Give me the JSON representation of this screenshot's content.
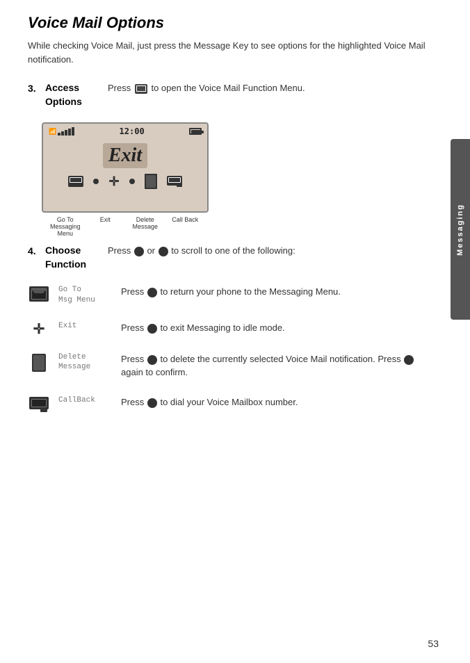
{
  "page": {
    "title": "Voice Mail Options",
    "intro": "While checking Voice Mail, just press the Message Key to see options for the highlighted Voice Mail notification.",
    "page_number": "53",
    "side_tab": "Messaging"
  },
  "steps": [
    {
      "number": "3.",
      "label": "Access\nOptions",
      "description": "Press  to open the Voice Mail Function Menu."
    },
    {
      "number": "4.",
      "label": "Choose\nFunction",
      "description": "Press  or  to scroll to one of the following:"
    }
  ],
  "screen": {
    "time": "12:00",
    "exit_text": "Exit"
  },
  "screen_labels": [
    "Go To\nMessaging\nMenu",
    "Exit",
    "Delete\nMessage",
    "Call Back"
  ],
  "functions": [
    {
      "icon_type": "envelope",
      "name": "Go To\nMsg Menu",
      "description": "Press  to return your phone to the Messaging Menu."
    },
    {
      "icon_type": "plus",
      "name": "Exit",
      "description": "Press  to exit Messaging to idle mode."
    },
    {
      "icon_type": "delete",
      "name": "Delete\nMessage",
      "description": "Press  to delete the currently selected Voice Mail notification. Press  again to confirm."
    },
    {
      "icon_type": "callback",
      "name": "CallBack",
      "description": "Press  to dial your Voice Mailbox number."
    }
  ]
}
